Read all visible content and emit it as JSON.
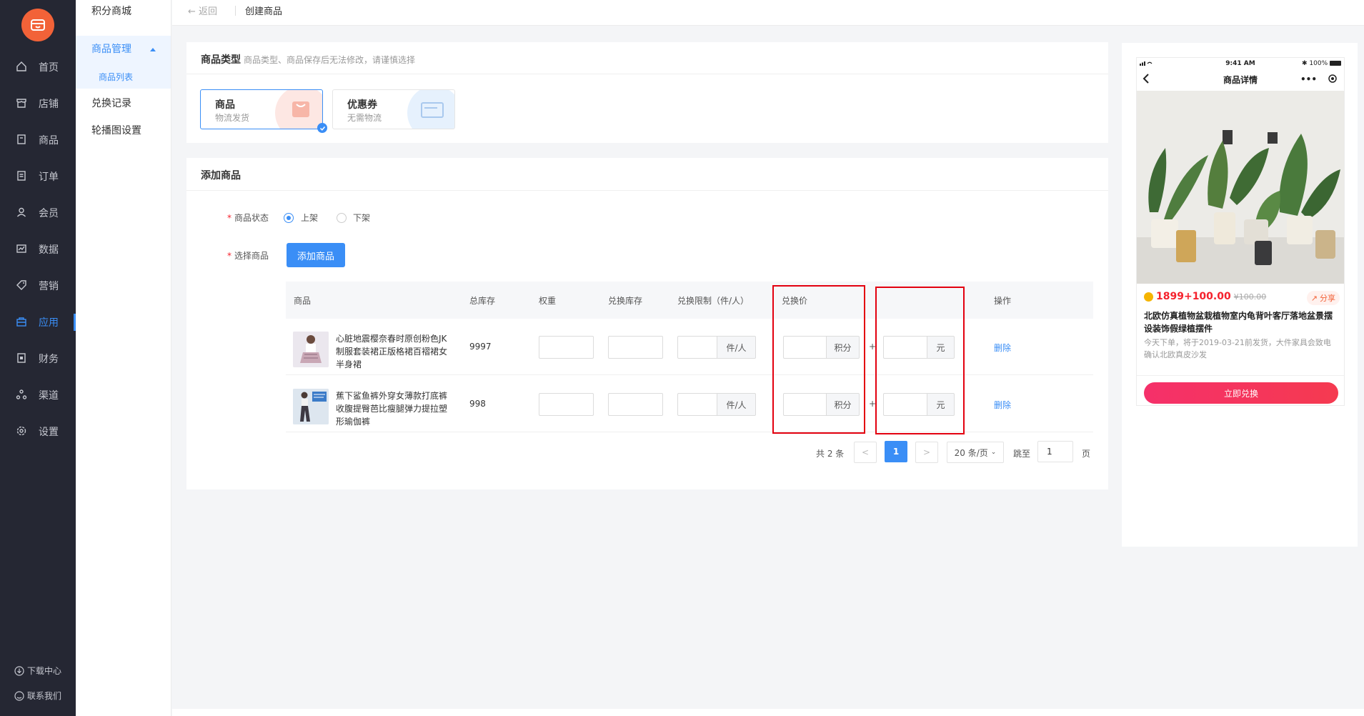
{
  "sidebar": {
    "items": [
      {
        "label": "首页",
        "icon": "home-icon"
      },
      {
        "label": "店铺",
        "icon": "store-icon"
      },
      {
        "label": "商品",
        "icon": "goods-icon"
      },
      {
        "label": "订单",
        "icon": "order-icon"
      },
      {
        "label": "会员",
        "icon": "member-icon"
      },
      {
        "label": "数据",
        "icon": "data-icon"
      },
      {
        "label": "营销",
        "icon": "tag-icon"
      },
      {
        "label": "应用",
        "icon": "app-icon"
      },
      {
        "label": "财务",
        "icon": "finance-icon"
      },
      {
        "label": "渠道",
        "icon": "channel-icon"
      },
      {
        "label": "设置",
        "icon": "gear-icon"
      }
    ],
    "active_index": 7,
    "download": "下载中心",
    "contact": "联系我们"
  },
  "subnav": {
    "title": "积分商城",
    "group": "商品管理",
    "group_child": "商品列表",
    "exchange": "兑换记录",
    "carousel": "轮播图设置"
  },
  "topbar": {
    "back": "返回",
    "crumb": "创建商品"
  },
  "goods_type": {
    "title": "商品类型",
    "hint": "商品类型、商品保存后无法修改，请谨慎选择",
    "options": [
      {
        "title": "商品",
        "sub": "物流发货",
        "selected": true
      },
      {
        "title": "优惠券",
        "sub": "无需物流",
        "selected": false
      }
    ]
  },
  "add_goods": {
    "title": "添加商品",
    "status_label": "商品状态",
    "status_on": "上架",
    "status_off": "下架",
    "select_label": "选择商品",
    "add_button": "添加商品"
  },
  "table": {
    "headers": {
      "product": "商品",
      "stock": "总库存",
      "weight": "权重",
      "exchange_stock": "兑换库存",
      "limit": "兑换限制（件/人）",
      "price": "兑换价",
      "action": "操作"
    },
    "limit_suffix": "件/人",
    "points_suffix": "积分",
    "plus": "+",
    "yuan_suffix": "元",
    "rows": [
      {
        "name": "心脏地震樱奈春时原创粉色JK制服套装裙正版格裙百褶裙女半身裙",
        "stock": "9997",
        "action": "删除"
      },
      {
        "name": "蕉下鲨鱼裤外穿女薄款打底裤收腹提臀芭比瘦腿弹力提拉塑形瑜伽裤",
        "stock": "998",
        "action": "删除"
      }
    ]
  },
  "pagination": {
    "total": "共 2 条",
    "prev": "<",
    "current": "1",
    "next": ">",
    "page_size": "20 条/页",
    "jump_label": "跳至",
    "jump_value": "1",
    "page_unit": "页"
  },
  "preview": {
    "time": "9:41 AM",
    "battery": "100%",
    "title": "商品详情",
    "price": "1899+100.00",
    "old_price": "¥100.00",
    "share": "分享",
    "name": "北欧仿真植物盆栽植物室内龟背叶客厅落地盆景摆设装饰假绿植摆件",
    "desc": "今天下单，将于2019-03-21前发货，大件家具会致电确认北欧真皮沙发",
    "redeem": "立即兑换"
  },
  "colors": {
    "primary": "#3a8ef6",
    "sidebar_bg": "#252733",
    "logo": "#f26238",
    "highlight_box": "#e3000f",
    "price": "#f5222d"
  }
}
